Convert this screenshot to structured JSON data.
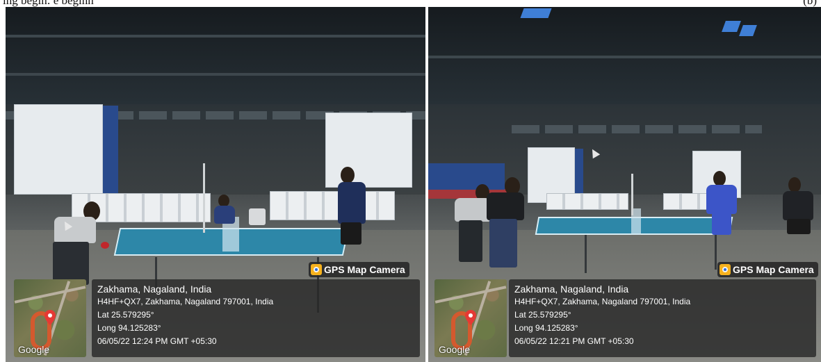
{
  "caption": {
    "left_fragment": "ing begin: e beginn",
    "right_fragment": "(b)"
  },
  "photos": [
    {
      "id_label": "left",
      "badge": {
        "icon": "gps-camera-icon",
        "label": "GPS Map Camera"
      },
      "map": {
        "logo": "Google",
        "icon": "location-pin-icon"
      },
      "info": {
        "place": "Zakhama, Nagaland, India",
        "address": "H4HF+QX7, Zakhama, Nagaland 797001, India",
        "lat": "Lat 25.579295°",
        "long": "Long 94.125283°",
        "datetime": "06/05/22 12:24 PM GMT +05:30"
      }
    },
    {
      "id_label": "right",
      "badge": {
        "icon": "gps-camera-icon",
        "label": "GPS Map Camera"
      },
      "map": {
        "logo": "Google",
        "icon": "location-pin-icon"
      },
      "info": {
        "place": "Zakhama, Nagaland, India",
        "address": "H4HF+QX7, Zakhama, Nagaland 797001, India",
        "lat": "Lat 25.579295°",
        "long": "Long 94.125283°",
        "datetime": "06/05/22 12:21 PM GMT +05:30"
      }
    }
  ],
  "colors": {
    "badge_icon": "#f6b21e",
    "pin": "#e53935",
    "table": "#2d87a8",
    "panel": "#282828"
  }
}
